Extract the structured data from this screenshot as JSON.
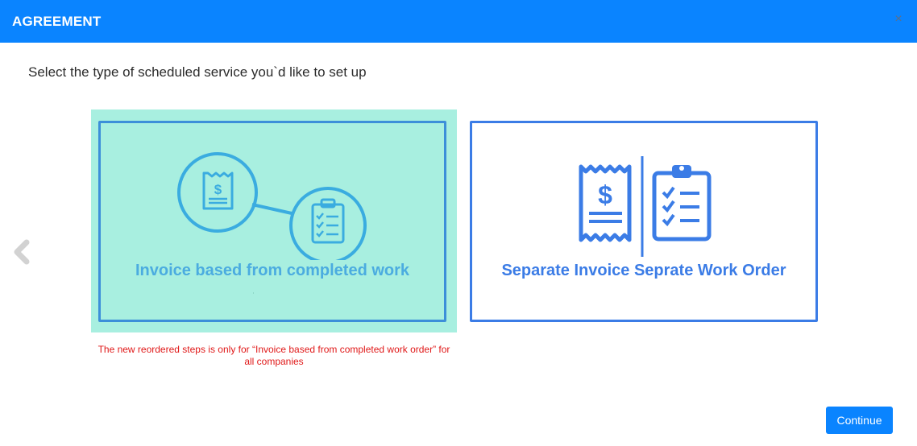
{
  "dialog": {
    "title": "AGREEMENT",
    "close_symbol": "×",
    "prompt": "Select the type of scheduled service you`d like to set up"
  },
  "options": [
    {
      "label": "Invoice based from completed work",
      "icon": "invoice-to-clipboard-icon",
      "selected": true
    },
    {
      "label": "Separate Invoice Seprate Work Order",
      "icon": "invoice-and-clipboard-icon",
      "selected": false
    }
  ],
  "note": "The new reordered steps is only for “Invoice based from completed work order” for all companies",
  "actions": {
    "continue_label": "Continue"
  },
  "colors": {
    "header": "#0a84ff",
    "selected_bg": "#a8efe0",
    "card_border": "#3b7ce6",
    "note": "#e01818"
  }
}
